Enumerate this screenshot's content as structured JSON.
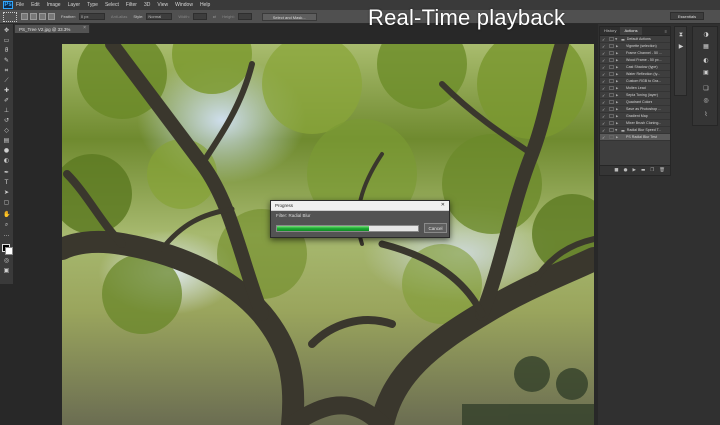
{
  "overlay": {
    "title": "Real-Time playback"
  },
  "menubar": {
    "logo": "Ps",
    "items": [
      "File",
      "Edit",
      "Image",
      "Layer",
      "Type",
      "Select",
      "Filter",
      "3D",
      "View",
      "Window",
      "Help"
    ]
  },
  "options": {
    "feather_label": "Feather:",
    "feather_value": "0 px",
    "antialias_label": "Anti-alias",
    "style_label": "Style:",
    "style_value": "Normal",
    "width_label": "Width:",
    "height_label": "Height:",
    "select_mask_label": "Select and Mask...",
    "workspace_label": "Essentials"
  },
  "document": {
    "tab_label": "PS_Tree V2.jpg @ 33.3% (RGB/8*)",
    "close_glyph": "×"
  },
  "toolbar": {
    "icons": [
      "move-tool",
      "marquee-tool",
      "lasso-tool",
      "quick-select-tool",
      "crop-tool",
      "eyedropper-tool",
      "healing-tool",
      "brush-tool",
      "clone-stamp-tool",
      "history-brush-tool",
      "eraser-tool",
      "gradient-tool",
      "blur-tool",
      "dodge-tool",
      "pen-tool",
      "type-tool",
      "path-select-tool",
      "shape-tool",
      "hand-tool",
      "zoom-tool"
    ]
  },
  "panel": {
    "tabs": [
      "History",
      "Actions"
    ],
    "active_tab": "Actions",
    "menu_glyph": "≡",
    "actions": [
      {
        "label": "Default Actions",
        "type": "set"
      },
      {
        "label": "Vignette (selection)",
        "type": "action"
      },
      {
        "label": "Frame Channel - 50 ...",
        "type": "action"
      },
      {
        "label": "Wood Frame - 50 px...",
        "type": "action"
      },
      {
        "label": "Cast Shadow (type)",
        "type": "action"
      },
      {
        "label": "Water Reflection (ty...",
        "type": "action"
      },
      {
        "label": "Custom RGB to Gra...",
        "type": "action"
      },
      {
        "label": "Molten Lead",
        "type": "action"
      },
      {
        "label": "Sepia Toning (layer)",
        "type": "action"
      },
      {
        "label": "Quadrant Colors",
        "type": "action"
      },
      {
        "label": "Save as Photoshop ...",
        "type": "action"
      },
      {
        "label": "Gradient Map",
        "type": "action"
      },
      {
        "label": "Mixer Brush Cloning...",
        "type": "action"
      },
      {
        "label": "Radial Blur Speed T...",
        "type": "set"
      },
      {
        "label": "PS Radial Blur Test",
        "type": "action",
        "selected": true
      }
    ],
    "footer_icons": [
      "stop-icon",
      "record-icon",
      "play-icon",
      "new-set-icon",
      "new-action-icon",
      "delete-icon"
    ]
  },
  "dialog": {
    "title": "Progress",
    "close_glyph": "✕",
    "filter_text": "Filter: Radial Blur",
    "progress": 0.65,
    "cancel_label": "Cancel"
  }
}
